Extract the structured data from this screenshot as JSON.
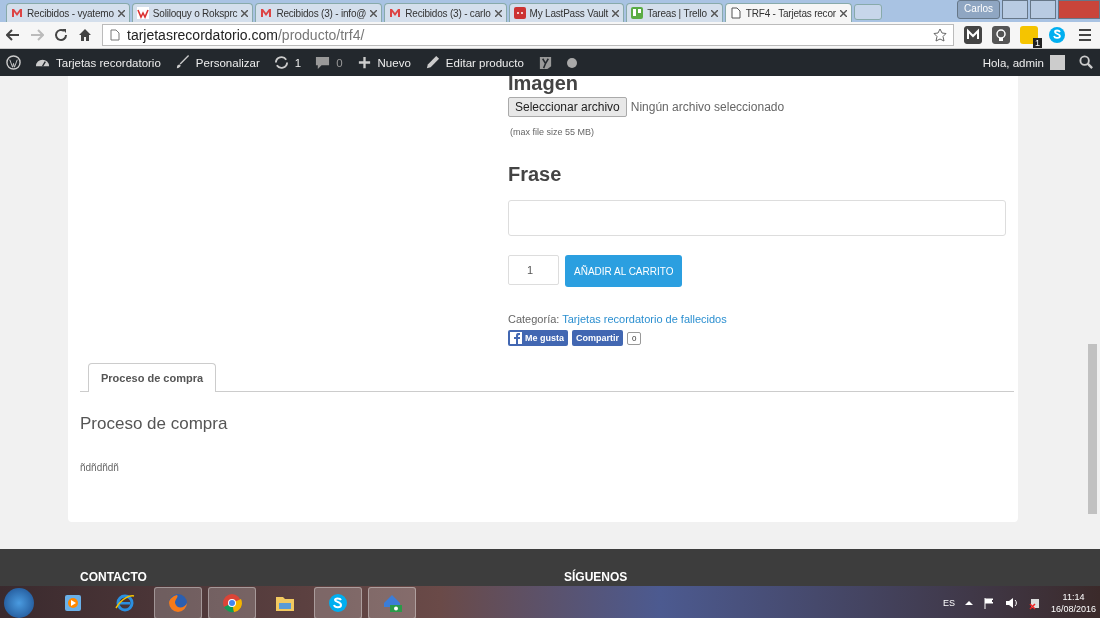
{
  "browser": {
    "tabs": [
      {
        "title": "Recibidos - vyatemo",
        "kind": "mail",
        "selected": false
      },
      {
        "title": "Soliloquy o Roksprc",
        "kind": "w",
        "selected": false
      },
      {
        "title": "Recibidos (3) - info@",
        "kind": "mail",
        "selected": false
      },
      {
        "title": "Recibidos (3) - carlo",
        "kind": "mail",
        "selected": false
      },
      {
        "title": "My LastPass Vault",
        "kind": "vault",
        "selected": false
      },
      {
        "title": "Tareas | Trello",
        "kind": "board",
        "selected": false
      },
      {
        "title": "TRF4 - Tarjetas recor",
        "kind": "page",
        "selected": true
      }
    ],
    "profile": "Carlos",
    "url_host": "tarjetasrecordatorio.com",
    "url_path": "/producto/trf4/",
    "extension_badge": "1"
  },
  "admin_bar": {
    "site": "Tarjetas recordatorio",
    "customize": "Personalizar",
    "updates": "1",
    "comments": "0",
    "new": "Nuevo",
    "edit": "Editar producto",
    "greeting": "Hola, admin"
  },
  "product": {
    "image_heading": "Imagen",
    "file_button": "Seleccionar archivo",
    "file_status": "Ningún archivo seleccionado",
    "file_note": "(max file size 55 MB)",
    "phrase_heading": "Frase",
    "quantity": "1",
    "add_to_cart": "AÑADIR AL CARRITO",
    "category_label": "Categoría:",
    "category_link": "Tarjetas recordatorio de fallecidos",
    "like": "Me gusta",
    "share": "Compartir",
    "share_count": "0"
  },
  "tabs": [
    {
      "label": "Proceso de compra",
      "selected": true
    }
  ],
  "tab_panel": {
    "heading": "Proceso de compra",
    "text": "ñdñdñdñ"
  },
  "footer": {
    "columns": [
      "CONTACTO",
      "SÍGUENOS"
    ]
  },
  "taskbar": {
    "apps": [
      {
        "kind": "media",
        "open": false
      },
      {
        "kind": "ie",
        "open": false
      },
      {
        "kind": "firefox",
        "open": true
      },
      {
        "kind": "chrome",
        "open": true
      },
      {
        "kind": "folder",
        "open": false
      },
      {
        "kind": "skype",
        "open": true
      },
      {
        "kind": "house",
        "open": true
      }
    ],
    "language": "ES",
    "time": "11:14",
    "date": "16/08/2016"
  }
}
